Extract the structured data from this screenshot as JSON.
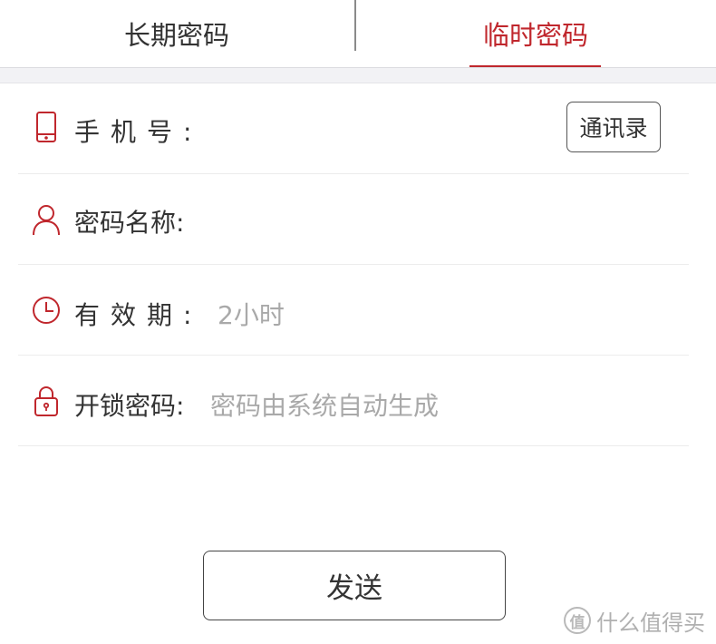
{
  "tabs": {
    "long_term": "长期密码",
    "temporary": "临时密码",
    "active": "temporary"
  },
  "form": {
    "phone": {
      "label": "手机号:",
      "icon": "phone-icon",
      "contacts_button": "通讯录"
    },
    "name": {
      "label": "密码名称:",
      "icon": "person-icon"
    },
    "validity": {
      "label": "有效期:",
      "value": "2小时",
      "icon": "clock-icon"
    },
    "code": {
      "label": "开锁密码:",
      "placeholder": "密码由系统自动生成",
      "icon": "lock-icon"
    }
  },
  "send_button": "发送",
  "watermark": {
    "logo": "值",
    "text": "什么值得买"
  },
  "colors": {
    "accent": "#c0272d",
    "text": "#333333",
    "placeholder": "#a9a9a9",
    "divider": "#ececec"
  }
}
